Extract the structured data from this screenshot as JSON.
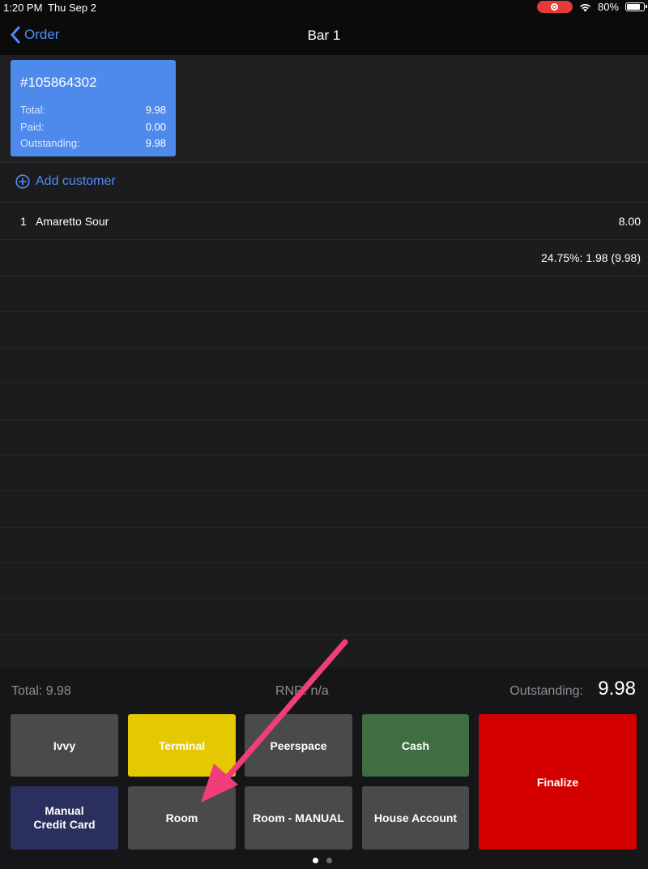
{
  "status_bar": {
    "time": "1:20 PM",
    "date": "Thu Sep 2",
    "battery_text": "80%",
    "battery_level": 0.8,
    "recording_color": "#e53a36"
  },
  "nav": {
    "back_label": "Order",
    "title": "Bar 1"
  },
  "check": {
    "number": "#105864302",
    "rows": [
      {
        "label": "Total:",
        "value": "9.98"
      },
      {
        "label": "Paid:",
        "value": "0.00"
      },
      {
        "label": "Outstanding:",
        "value": "9.98"
      }
    ],
    "color": "#4e8aeb"
  },
  "add_customer_label": "Add customer",
  "items": [
    {
      "qty": "1",
      "name": "Amaretto Sour",
      "price": "8.00"
    }
  ],
  "tax_line": "24.75%: 1.98 (9.98)",
  "summary": {
    "total": "Total: 9.98",
    "rnr": "RNR: n/a",
    "outstanding_label": "Outstanding:",
    "outstanding_value": "9.98"
  },
  "buttons": {
    "ivvy": "Ivvy",
    "terminal": "Terminal",
    "peerspace": "Peerspace",
    "cash": "Cash",
    "finalize": "Finalize",
    "manual_cc_line1": "Manual",
    "manual_cc_line2": "Credit Card",
    "room": "Room",
    "room_manual": "Room - MANUAL",
    "house_account": "House Account"
  },
  "colors": {
    "accent": "#4f8df7",
    "terminal": "#e4c800",
    "cash": "#3f6e42",
    "finalize": "#d40000",
    "manual_cc": "#2a2f5e",
    "neutral_button": "#4a4a4c",
    "annotation_arrow": "#f23d7c"
  },
  "pager": {
    "pages": 2,
    "current": 1
  }
}
